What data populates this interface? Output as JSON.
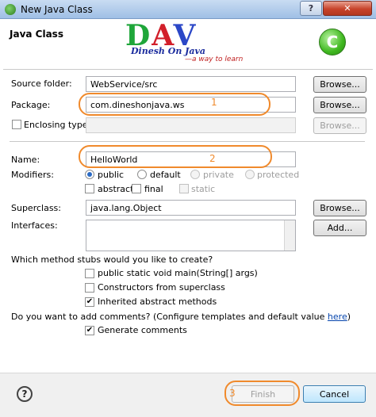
{
  "window": {
    "title": "New Java Class",
    "help_button": "?",
    "close_button": "✕"
  },
  "header": {
    "title": "Java Class",
    "logo": {
      "letter1": "D",
      "letter2": "A",
      "letter3": "V",
      "line1": "Dinesh On Java",
      "line2": "—a way to learn"
    },
    "wizard_icon_letter": "C"
  },
  "form": {
    "source_folder": {
      "label": "Source folder:",
      "value": "WebService/src",
      "button": "Browse..."
    },
    "package": {
      "label": "Package:",
      "value": "com.dineshonjava.ws",
      "button": "Browse..."
    },
    "enclosing_type": {
      "label": "Enclosing type:",
      "value": "",
      "button": "Browse..."
    },
    "name": {
      "label": "Name:",
      "value": "HelloWorld"
    },
    "modifiers": {
      "label": "Modifiers:",
      "public": "public",
      "default": "default",
      "private": "private",
      "protected": "protected",
      "abstract": "abstract",
      "final": "final",
      "static": "static"
    },
    "superclass": {
      "label": "Superclass:",
      "value": "java.lang.Object",
      "button": "Browse..."
    },
    "interfaces": {
      "label": "Interfaces:",
      "button": "Add..."
    },
    "stubs_question": "Which method stubs would you like to create?",
    "stubs": {
      "main": "public static void main(String[] args)",
      "constructors": "Constructors from superclass",
      "inherited": "Inherited abstract methods"
    },
    "comments_question_prefix": "Do you want to add comments? (Configure templates and default value ",
    "comments_link": "here",
    "comments_question_suffix": ")",
    "generate_comments": "Generate comments"
  },
  "annotations": {
    "n1": "1",
    "n2": "2",
    "n3": "3",
    "color": "#f08a2c"
  },
  "footer": {
    "help": "?",
    "finish": "Finish",
    "cancel": "Cancel"
  }
}
